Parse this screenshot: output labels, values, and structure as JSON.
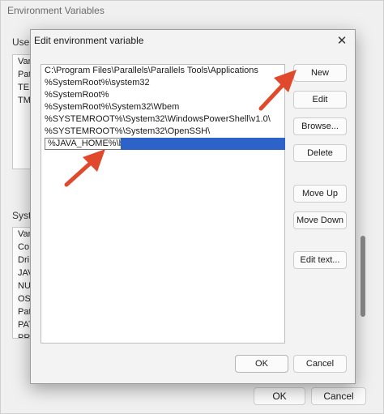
{
  "parent": {
    "title": "Environment Variables",
    "user_label": "User",
    "system_label": "Syste",
    "user_list": [
      "Vari",
      "Pat",
      "TEI",
      "TM"
    ],
    "system_list": [
      "Vari",
      "Co",
      "Dri",
      "JAV",
      "NU",
      "OS",
      "Pat",
      "PAT",
      "PR"
    ],
    "ok_label": "OK",
    "cancel_label": "Cancel"
  },
  "dialog": {
    "title": "Edit environment variable",
    "close_glyph": "✕",
    "paths": [
      "C:\\Program Files\\Parallels\\Parallels Tools\\Applications",
      "%SystemRoot%\\system32",
      "%SystemRoot%",
      "%SystemRoot%\\System32\\Wbem",
      "%SYSTEMROOT%\\System32\\WindowsPowerShell\\v1.0\\",
      "%SYSTEMROOT%\\System32\\OpenSSH\\"
    ],
    "editing_value": "%JAVA_HOME%\\bin",
    "buttons": {
      "new": "New",
      "edit": "Edit",
      "browse": "Browse...",
      "delete": "Delete",
      "move_up": "Move Up",
      "move_down": "Move Down",
      "edit_text": "Edit text...",
      "ok": "OK",
      "cancel": "Cancel"
    }
  },
  "colors": {
    "selection": "#2d63c8",
    "arrow": "#e0492c"
  }
}
